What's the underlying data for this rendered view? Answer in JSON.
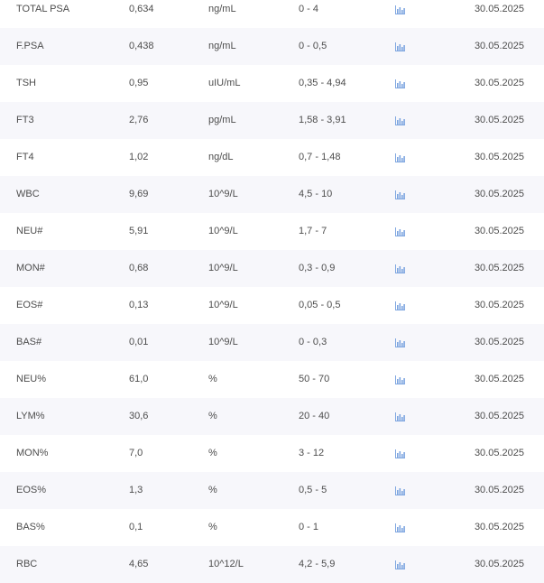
{
  "colors": {
    "row_alt": "#f7f7fb",
    "text": "#4d4d4d",
    "chart_icon": "#7ea6e0"
  },
  "results": {
    "rows": [
      {
        "name": "TOTAL PSA",
        "value": "0,634",
        "unit": "ng/mL",
        "range": "0 - 4",
        "icon": "bar-chart-icon",
        "date": "30.05.2025"
      },
      {
        "name": "F.PSA",
        "value": "0,438",
        "unit": "ng/mL",
        "range": "0 - 0,5",
        "icon": "bar-chart-icon",
        "date": "30.05.2025"
      },
      {
        "name": "TSH",
        "value": "0,95",
        "unit": "uIU/mL",
        "range": "0,35 - 4,94",
        "icon": "bar-chart-icon",
        "date": "30.05.2025"
      },
      {
        "name": "FT3",
        "value": "2,76",
        "unit": "pg/mL",
        "range": "1,58 - 3,91",
        "icon": "bar-chart-icon",
        "date": "30.05.2025"
      },
      {
        "name": "FT4",
        "value": "1,02",
        "unit": "ng/dL",
        "range": "0,7 - 1,48",
        "icon": "bar-chart-icon",
        "date": "30.05.2025"
      },
      {
        "name": "WBC",
        "value": "9,69",
        "unit": "10^9/L",
        "range": "4,5 - 10",
        "icon": "bar-chart-icon",
        "date": "30.05.2025"
      },
      {
        "name": "NEU#",
        "value": "5,91",
        "unit": "10^9/L",
        "range": "1,7 - 7",
        "icon": "bar-chart-icon",
        "date": "30.05.2025"
      },
      {
        "name": "MON#",
        "value": "0,68",
        "unit": "10^9/L",
        "range": "0,3 - 0,9",
        "icon": "bar-chart-icon",
        "date": "30.05.2025"
      },
      {
        "name": "EOS#",
        "value": "0,13",
        "unit": "10^9/L",
        "range": "0,05 - 0,5",
        "icon": "bar-chart-icon",
        "date": "30.05.2025"
      },
      {
        "name": "BAS#",
        "value": "0,01",
        "unit": "10^9/L",
        "range": "0 - 0,3",
        "icon": "bar-chart-icon",
        "date": "30.05.2025"
      },
      {
        "name": "NEU%",
        "value": "61,0",
        "unit": "%",
        "range": "50 - 70",
        "icon": "bar-chart-icon",
        "date": "30.05.2025"
      },
      {
        "name": "LYM%",
        "value": "30,6",
        "unit": "%",
        "range": "20 - 40",
        "icon": "bar-chart-icon",
        "date": "30.05.2025"
      },
      {
        "name": "MON%",
        "value": "7,0",
        "unit": "%",
        "range": "3 - 12",
        "icon": "bar-chart-icon",
        "date": "30.05.2025"
      },
      {
        "name": "EOS%",
        "value": "1,3",
        "unit": "%",
        "range": "0,5 - 5",
        "icon": "bar-chart-icon",
        "date": "30.05.2025"
      },
      {
        "name": "BAS%",
        "value": "0,1",
        "unit": "%",
        "range": "0 - 1",
        "icon": "bar-chart-icon",
        "date": "30.05.2025"
      },
      {
        "name": "RBC",
        "value": "4,65",
        "unit": "10^12/L",
        "range": "4,2 - 5,9",
        "icon": "bar-chart-icon",
        "date": "30.05.2025"
      }
    ]
  }
}
